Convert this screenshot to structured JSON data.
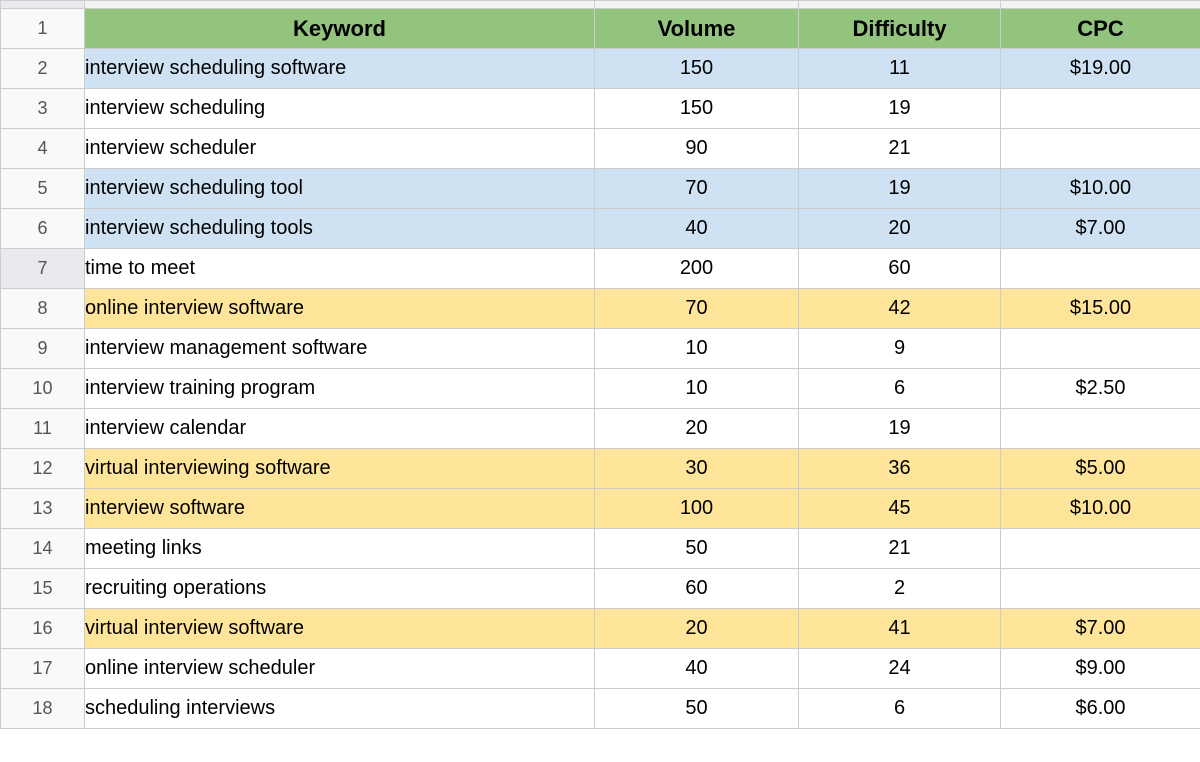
{
  "headers": {
    "keyword": "Keyword",
    "volume": "Volume",
    "difficulty": "Difficulty",
    "cpc": "CPC"
  },
  "selected_row": 7,
  "rows": [
    {
      "n": 1,
      "hdr": true
    },
    {
      "n": 2,
      "keyword": "interview scheduling software",
      "volume": "150",
      "difficulty": "11",
      "cpc": "$19.00",
      "color": "blue"
    },
    {
      "n": 3,
      "keyword": "interview scheduling",
      "volume": "150",
      "difficulty": "19",
      "cpc": "",
      "color": "white"
    },
    {
      "n": 4,
      "keyword": "interview scheduler",
      "volume": "90",
      "difficulty": "21",
      "cpc": "",
      "color": "white"
    },
    {
      "n": 5,
      "keyword": "interview scheduling tool",
      "volume": "70",
      "difficulty": "19",
      "cpc": "$10.00",
      "color": "blue"
    },
    {
      "n": 6,
      "keyword": "interview scheduling tools",
      "volume": "40",
      "difficulty": "20",
      "cpc": "$7.00",
      "color": "blue"
    },
    {
      "n": 7,
      "keyword": "time to meet",
      "volume": "200",
      "difficulty": "60",
      "cpc": "",
      "color": "white"
    },
    {
      "n": 8,
      "keyword": "online interview software",
      "volume": "70",
      "difficulty": "42",
      "cpc": "$15.00",
      "color": "yellow"
    },
    {
      "n": 9,
      "keyword": "interview management software",
      "volume": "10",
      "difficulty": "9",
      "cpc": "",
      "color": "white"
    },
    {
      "n": 10,
      "keyword": "interview training program",
      "volume": "10",
      "difficulty": "6",
      "cpc": "$2.50",
      "color": "white"
    },
    {
      "n": 11,
      "keyword": "interview calendar",
      "volume": "20",
      "difficulty": "19",
      "cpc": "",
      "color": "white"
    },
    {
      "n": 12,
      "keyword": "virtual interviewing software",
      "volume": "30",
      "difficulty": "36",
      "cpc": "$5.00",
      "color": "yellow"
    },
    {
      "n": 13,
      "keyword": "interview software",
      "volume": "100",
      "difficulty": "45",
      "cpc": "$10.00",
      "color": "yellow"
    },
    {
      "n": 14,
      "keyword": "meeting links",
      "volume": "50",
      "difficulty": "21",
      "cpc": "",
      "color": "white"
    },
    {
      "n": 15,
      "keyword": "recruiting operations",
      "volume": "60",
      "difficulty": "2",
      "cpc": "",
      "color": "white"
    },
    {
      "n": 16,
      "keyword": "virtual interview software",
      "volume": "20",
      "difficulty": "41",
      "cpc": "$7.00",
      "color": "yellow"
    },
    {
      "n": 17,
      "keyword": "online interview scheduler",
      "volume": "40",
      "difficulty": "24",
      "cpc": "$9.00",
      "color": "white"
    },
    {
      "n": 18,
      "keyword": "scheduling interviews",
      "volume": "50",
      "difficulty": "6",
      "cpc": "$6.00",
      "color": "white"
    }
  ],
  "chart_data": {
    "type": "table",
    "columns": [
      "Keyword",
      "Volume",
      "Difficulty",
      "CPC"
    ],
    "rows": [
      [
        "interview scheduling software",
        150,
        11,
        19.0
      ],
      [
        "interview scheduling",
        150,
        19,
        null
      ],
      [
        "interview scheduler",
        90,
        21,
        null
      ],
      [
        "interview scheduling tool",
        70,
        19,
        10.0
      ],
      [
        "interview scheduling tools",
        40,
        20,
        7.0
      ],
      [
        "time to meet",
        200,
        60,
        null
      ],
      [
        "online interview software",
        70,
        42,
        15.0
      ],
      [
        "interview management software",
        10,
        9,
        null
      ],
      [
        "interview training program",
        10,
        6,
        2.5
      ],
      [
        "interview calendar",
        20,
        19,
        null
      ],
      [
        "virtual interviewing software",
        30,
        36,
        5.0
      ],
      [
        "interview software",
        100,
        45,
        10.0
      ],
      [
        "meeting links",
        50,
        21,
        null
      ],
      [
        "recruiting operations",
        60,
        2,
        null
      ],
      [
        "virtual interview software",
        20,
        41,
        7.0
      ],
      [
        "online interview scheduler",
        40,
        24,
        9.0
      ],
      [
        "scheduling interviews",
        50,
        6,
        6.0
      ]
    ]
  }
}
